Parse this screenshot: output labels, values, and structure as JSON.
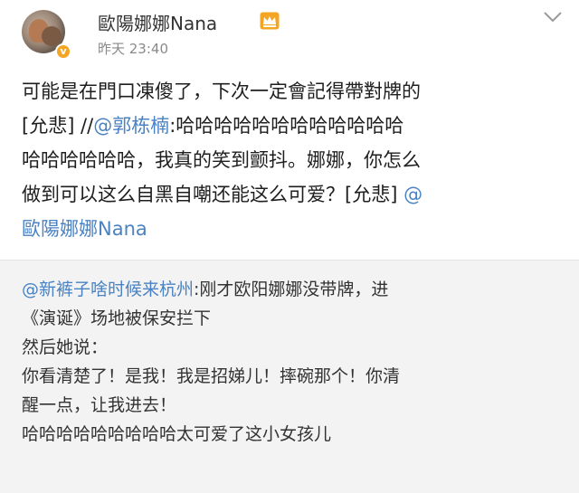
{
  "post": {
    "username": "歐陽娜娜Nana",
    "timestamp": "昨天 23:40",
    "verified_label": "v",
    "lines": [
      {
        "segments": [
          {
            "text": "可能是在門口凍傻了，下次一定會記得帶對牌的"
          }
        ]
      },
      {
        "segments": [
          {
            "text": "[允悲] //"
          },
          {
            "text": "@郭栋楠",
            "link": true
          },
          {
            "text": ":哈哈哈哈哈哈哈哈哈哈哈哈"
          }
        ]
      },
      {
        "segments": [
          {
            "text": "哈哈哈哈哈哈，我真的笑到颤抖。娜娜，你怎么"
          }
        ]
      },
      {
        "segments": [
          {
            "text": "做到可以这么自黑自嘲还能这么可爱？[允悲] "
          },
          {
            "text": "@",
            "link": true
          }
        ]
      },
      {
        "segments": [
          {
            "text": "歐陽娜娜Nana",
            "link": true
          }
        ]
      }
    ]
  },
  "retweet": {
    "lines": [
      {
        "segments": [
          {
            "text": "@新裤子啥时候来杭州",
            "link": true
          },
          {
            "text": ":刚才欧阳娜娜没带牌，进"
          }
        ]
      },
      {
        "segments": [
          {
            "text": "《演诞》场地被保安拦下"
          }
        ]
      },
      {
        "segments": [
          {
            "text": "然后她说："
          }
        ]
      },
      {
        "segments": [
          {
            "text": "你看清楚了！是我！我是招娣儿！摔碗那个！你清"
          }
        ]
      },
      {
        "segments": [
          {
            "text": "醒一点，让我进去！"
          }
        ]
      },
      {
        "segments": [
          {
            "text": "哈哈哈哈哈哈哈哈哈太可爱了这小女孩儿"
          }
        ]
      }
    ]
  },
  "icons": {
    "crown": "crown-icon",
    "chevron": "chevron-down-icon",
    "avatar": "avatar"
  },
  "colors": {
    "link": "#4a82c3",
    "retweet_bg": "#f3f3f3",
    "crown": "#f5a524"
  }
}
